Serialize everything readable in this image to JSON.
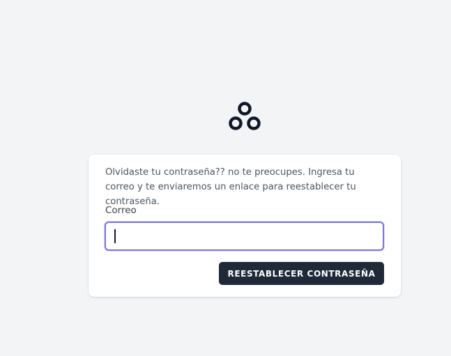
{
  "logo": {
    "icon": "three-circles-logo-icon",
    "color": "#111827"
  },
  "form": {
    "intro": "Olvidaste tu contraseña?? no te preocupes. Ingresa tu correo y te enviaremos un enlace para reestablecer tu contraseña.",
    "email_label": "Correo",
    "email_value": "",
    "submit_label": "REESTABLECER CONTRASEÑA"
  },
  "colors": {
    "background": "#f3f4f6",
    "card": "#ffffff",
    "button": "#1f2937",
    "focus_ring": "#7c75d6"
  }
}
